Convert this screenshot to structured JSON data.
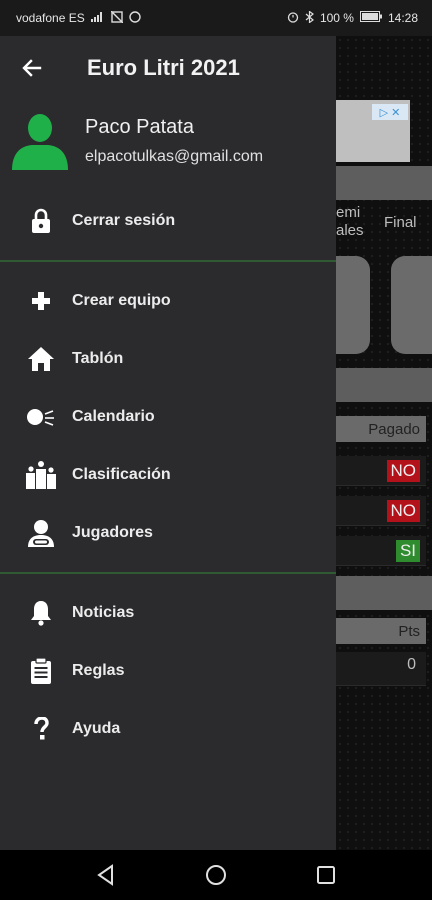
{
  "status_bar": {
    "carrier": "vodafone ES",
    "battery": "100 %",
    "time": "14:28"
  },
  "drawer": {
    "title": "Euro Litri 2021",
    "user": {
      "name": "Paco Patata",
      "email": "elpacotulkas@gmail.com"
    },
    "session_items": [
      {
        "label": "Cerrar sesión",
        "icon": "lock-icon"
      }
    ],
    "main_items": [
      {
        "label": "Crear equipo",
        "icon": "plus-icon"
      },
      {
        "label": "Tablón",
        "icon": "home-icon"
      },
      {
        "label": "Calendario",
        "icon": "ball-icon"
      },
      {
        "label": "Clasificación",
        "icon": "podium-icon"
      },
      {
        "label": "Jugadores",
        "icon": "player-icon"
      }
    ],
    "info_items": [
      {
        "label": "Noticias",
        "icon": "bell-icon"
      },
      {
        "label": "Reglas",
        "icon": "clipboard-icon"
      },
      {
        "label": "Ayuda",
        "icon": "question-icon"
      }
    ]
  },
  "background": {
    "tab_semifinal": "emi\nales",
    "tab_final": "Final",
    "pagado_header": "Pagado",
    "pagado_values": [
      "NO",
      "NO",
      "SI"
    ],
    "pts_header": "Pts",
    "pts_value": "0"
  },
  "colors": {
    "drawer_bg": "#2b2b2e",
    "divider": "#2f5a34",
    "avatar": "#1fb04a",
    "no_badge": "#b3121b",
    "si_badge": "#2e8b2e"
  }
}
